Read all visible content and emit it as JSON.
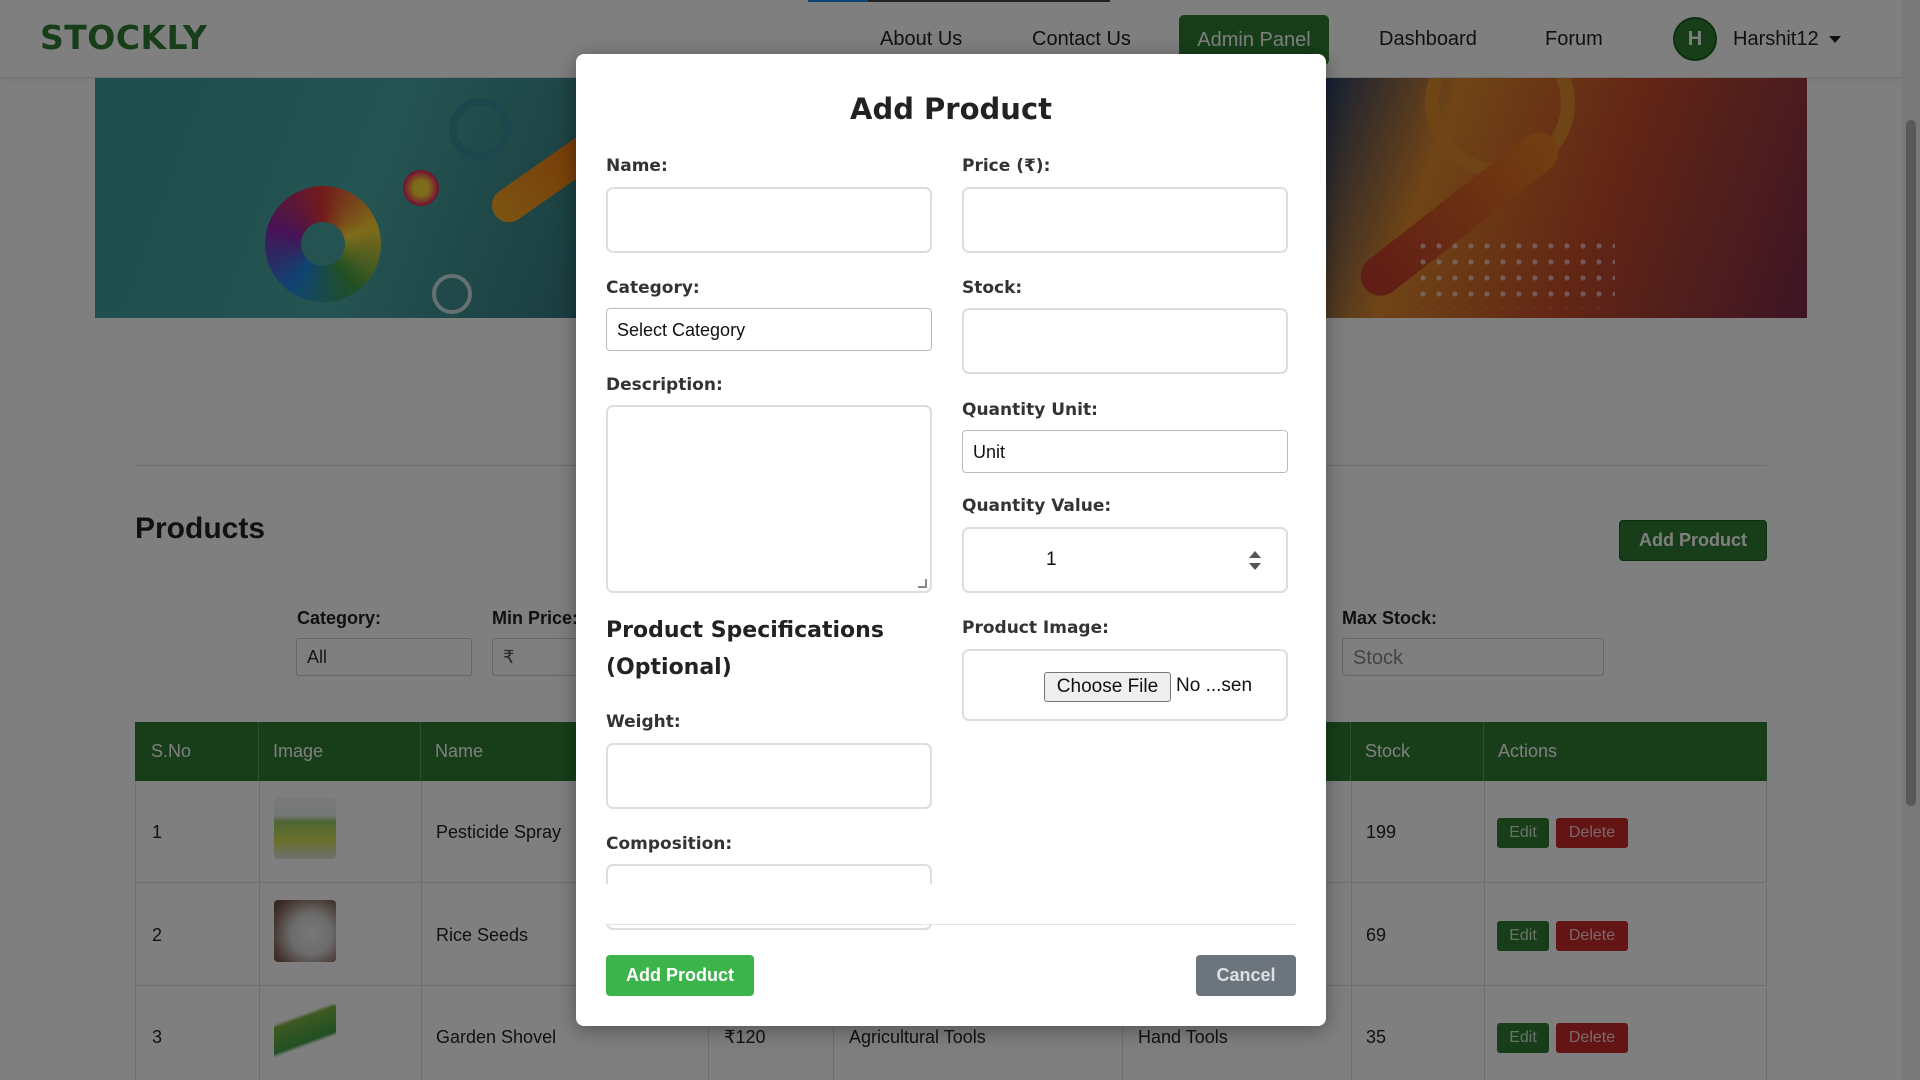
{
  "nav": {
    "brand": "STOCKLY",
    "links": [
      "About Us",
      "Contact Us",
      "Admin Panel",
      "Dashboard",
      "Forum"
    ],
    "avatar_initial": "H",
    "username": "Harshit12"
  },
  "page": {
    "products_title": "Products",
    "add_product_label": "Add Product",
    "filters": {
      "category_label": "Category:",
      "category_value": "All",
      "min_price_label": "Min Price:",
      "min_price_placeholder": "₹",
      "max_stock_label": "Max Stock:",
      "max_stock_placeholder": "Stock"
    },
    "table": {
      "headers": [
        "S.No",
        "Image",
        "Name",
        "Stock",
        "Actions"
      ],
      "rows": [
        {
          "sno": "1",
          "name": "Pesticide Spray",
          "price": "",
          "category": "",
          "subcategory": "",
          "stock": "199"
        },
        {
          "sno": "2",
          "name": "Rice Seeds",
          "price": "",
          "category": "",
          "subcategory": "",
          "stock": "69"
        },
        {
          "sno": "3",
          "name": "Garden Shovel",
          "price": "₹120",
          "category": "Agricultural Tools",
          "subcategory": "Hand Tools",
          "stock": "35"
        }
      ],
      "edit_label": "Edit",
      "delete_label": "Delete"
    }
  },
  "modal": {
    "title": "Add Product",
    "name_label": "Name:",
    "price_label": "Price (₹):",
    "category_label": "Category:",
    "category_value": "Select Category",
    "stock_label": "Stock:",
    "description_label": "Description:",
    "quantity_unit_label": "Quantity Unit:",
    "quantity_unit_value": "Unit",
    "quantity_value_label": "Quantity Value:",
    "quantity_value": "1",
    "spec_title": "Product Specifications (Optional)",
    "weight_label": "Weight:",
    "composition_label": "Composition:",
    "image_label": "Product Image:",
    "choose_file_label": "Choose File",
    "no_file_text": "No ...sen",
    "submit_label": "Add Product",
    "cancel_label": "Cancel"
  },
  "colors": {
    "brand_green": "#2e7d32",
    "submit_green": "#3cb44b",
    "cancel_gray": "#6c757d",
    "delete_red": "#c62828"
  }
}
